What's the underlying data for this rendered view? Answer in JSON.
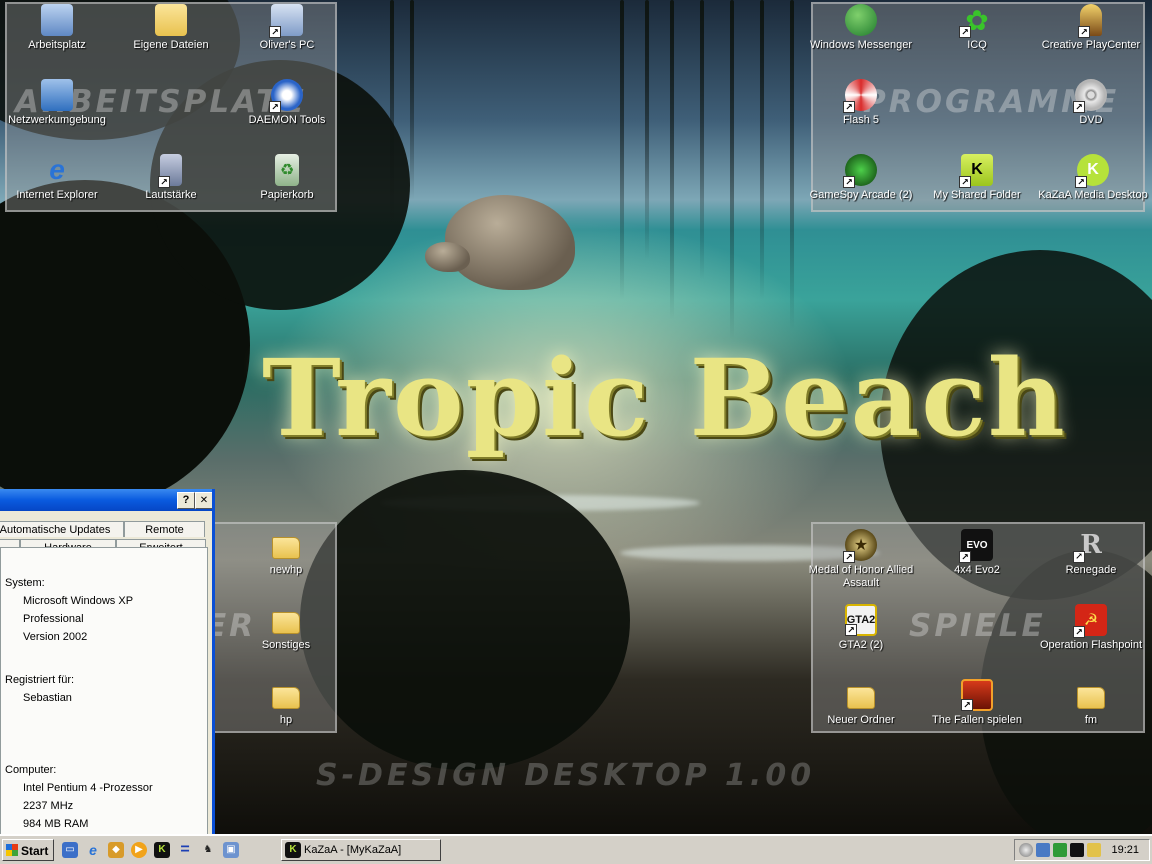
{
  "wallpaper": {
    "title": "Tropic Beach",
    "brand": "S-DESIGN DESKTOP 1.00",
    "panel_labels": {
      "arbeitsplatz": "ARBEITSPLATZ",
      "programme": "PROGRAMME",
      "spiele": "SPIELE",
      "left_fragment": "ER"
    }
  },
  "icons": {
    "arbeitsplatz": "Arbeitsplatz",
    "eigene_dateien": "Eigene Dateien",
    "olivers_pc": "Oliver's PC",
    "netzwerk": "Netzwerkumgebung",
    "daemon": "DAEMON Tools",
    "ie": "Internet Explorer",
    "lautstaerke": "Lautstärke",
    "papierkorb": "Papierkorb",
    "messenger": "Windows Messenger",
    "icq": "ICQ",
    "creative": "Creative PlayCenter",
    "flash": "Flash 5",
    "dvd": "DVD",
    "gamespy": "GameSpy Arcade (2)",
    "shared": "My Shared Folder",
    "kazaa_desktop": "KaZaA Media Desktop",
    "newhp": "newhp",
    "sonstiges": "Sonstiges",
    "hp": "hp",
    "medal": "Medal of Honor Allied Assault",
    "evo2": "4x4 Evo2",
    "renegade": "Renegade",
    "gta2": "GTA2 (2)",
    "flashpoint": "Operation Flashpoint",
    "neuer_ordner": "Neuer Ordner",
    "fallen": "The Fallen spielen",
    "fm": "fm"
  },
  "dialog": {
    "help": "?",
    "close": "✕",
    "tabs": {
      "updates": "Automatische Updates",
      "remote": "Remote",
      "hardware": "Hardware",
      "erweitert": "Erweitert"
    },
    "system_label": "System:",
    "os_name": "Microsoft Windows XP",
    "os_edition": "Professional",
    "os_version": "Version 2002",
    "registered_label": "Registriert für:",
    "registered_user": "Sebastian",
    "computer_label": "Computer:",
    "cpu": "Intel Pentium 4 -Prozessor",
    "mhz": "2237 MHz",
    "ram": "984 MB RAM"
  },
  "taskbar": {
    "start": "Start",
    "task_kazaa": "KaZaA - [MyKaZaA]",
    "clock": "19:21"
  },
  "colors": {
    "taskbar": "#d4d0c8",
    "title_bar": "#0a5bdf",
    "title_text": "#e9e584"
  }
}
